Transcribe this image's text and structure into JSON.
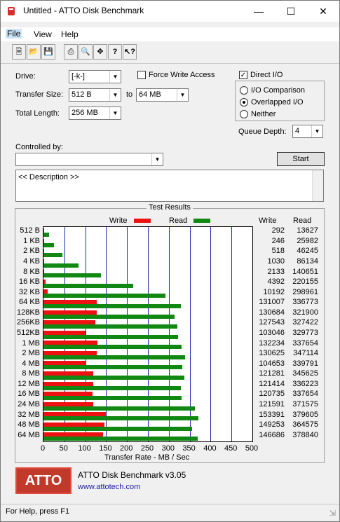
{
  "window": {
    "title": "Untitled - ATTO Disk Benchmark"
  },
  "menu": [
    "File",
    "View",
    "Help"
  ],
  "toolbar_icons": [
    "new-icon",
    "open-icon",
    "save-icon",
    "print-icon",
    "print-preview-icon",
    "move-icon",
    "help-icon",
    "context-help-icon"
  ],
  "form": {
    "drive_label": "Drive:",
    "drive_value": "[-k-]",
    "force_write_access": "Force Write Access",
    "direct_io": "Direct I/O",
    "transfer_size_label": "Transfer Size:",
    "transfer_from": "512 B",
    "to_label": "to",
    "transfer_to": "64 MB",
    "total_length_label": "Total Length:",
    "total_length_value": "256 MB",
    "io_comparison": "I/O Comparison",
    "overlapped_io": "Overlapped I/O",
    "neither": "Neither",
    "queue_depth_label": "Queue Depth:",
    "queue_depth_value": "4",
    "controlled_by_label": "Controlled by:",
    "controlled_by_value": "",
    "start_button": "Start",
    "description": "<< Description >>"
  },
  "results": {
    "group_title": "Test Results",
    "legend_write": "Write",
    "legend_read": "Read",
    "col_write": "Write",
    "col_read": "Read",
    "x_axis_label": "Transfer Rate - MB / Sec",
    "write_color": "#ee1111",
    "read_color": "#118811"
  },
  "chart_data": {
    "type": "bar",
    "categories": [
      "512 B",
      "1 KB",
      "2 KB",
      "4 KB",
      "8 KB",
      "16 KB",
      "32 KB",
      "64 KB",
      "128KB",
      "256KB",
      "512KB",
      "1 MB",
      "2 MB",
      "4 MB",
      "8 MB",
      "12 MB",
      "16 MB",
      "24 MB",
      "32 MB",
      "48 MB",
      "64 MB"
    ],
    "series": [
      {
        "name": "Write",
        "values": [
          292,
          246,
          518,
          1030,
          2133,
          4392,
          10192,
          131007,
          130684,
          127543,
          103046,
          132234,
          130625,
          104653,
          121281,
          121414,
          120735,
          121591,
          153391,
          149253,
          146686
        ]
      },
      {
        "name": "Read",
        "values": [
          13627,
          25982,
          46245,
          86134,
          140651,
          220155,
          298961,
          336773,
          321900,
          327422,
          329773,
          337654,
          347114,
          339791,
          345625,
          336223,
          337654,
          371575,
          379605,
          364575,
          378840
        ]
      }
    ],
    "xticks": [
      "0",
      "50",
      "100",
      "150",
      "200",
      "250",
      "300",
      "350",
      "400",
      "450",
      "500"
    ],
    "xlim": [
      0,
      500
    ],
    "xlabel": "Transfer Rate - MB / Sec"
  },
  "footer": {
    "product": "ATTO Disk Benchmark v3.05",
    "url": "www.attotech.com",
    "logo": "ATTO"
  },
  "status": "For Help, press F1"
}
